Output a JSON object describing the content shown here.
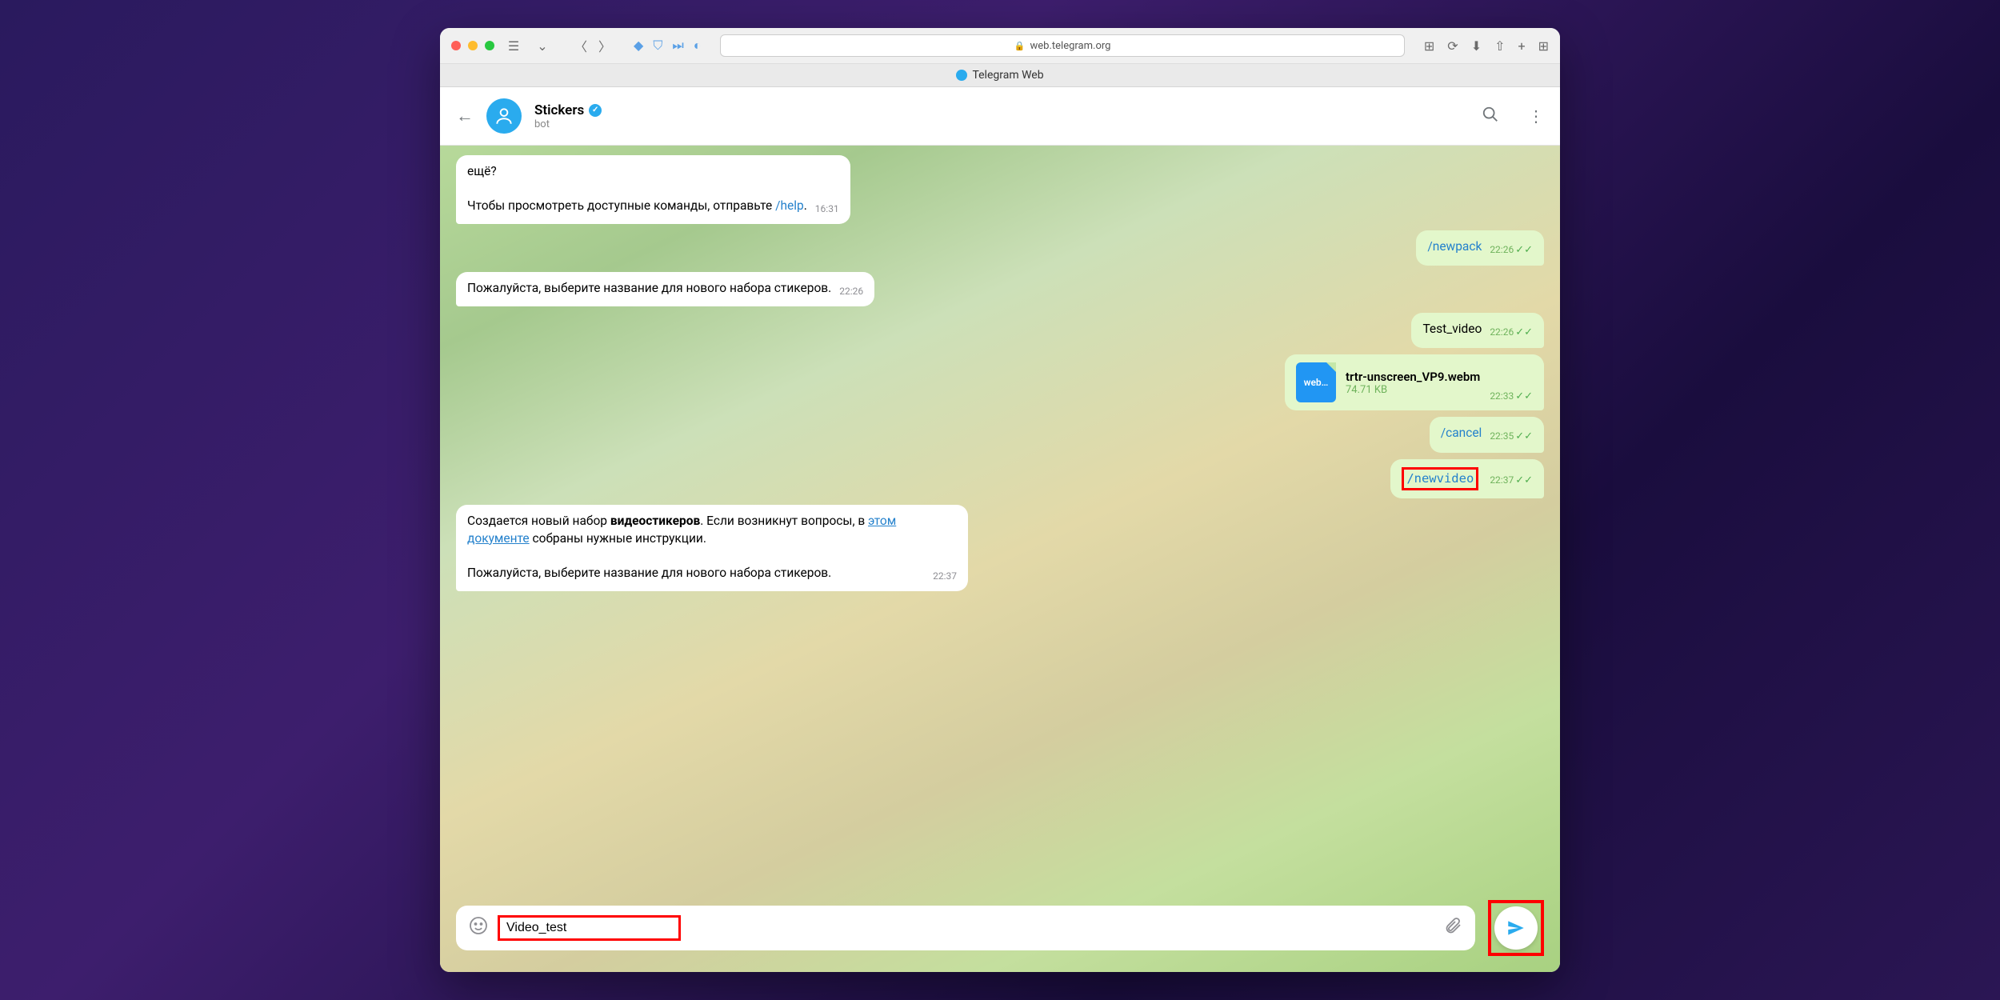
{
  "browser": {
    "url": "web.telegram.org",
    "tab_title": "Telegram Web"
  },
  "chat": {
    "name": "Stickers",
    "subtitle": "bot"
  },
  "messages": {
    "m1_line1": "ещё?",
    "m1_line2_pre": "Чтобы просмотреть доступные команды, отправьте ",
    "m1_cmd": "/help",
    "m1_post": ".",
    "m1_time": "16:31",
    "m2_cmd": "/newpack",
    "m2_time": "22:26",
    "m3_text": "Пожалуйста, выберите название для нового набора стикеров.",
    "m3_time": "22:26",
    "m4_text": "Test_video",
    "m4_time": "22:26",
    "file_name": "trtr-unscreen_VP9.webm",
    "file_size": "74.71 KB",
    "file_ext": "web…",
    "file_time": "22:33",
    "m6_cmd": "/cancel",
    "m6_time": "22:35",
    "m7_cmd": "/newvideo",
    "m7_time": "22:37",
    "m8_pre": "Создается новый набор ",
    "m8_bold": "видеостикеров",
    "m8_mid": ". Если возникнут вопросы, в ",
    "m8_link": "этом документе",
    "m8_post": " собраны нужные инструкции.",
    "m8_line2": "Пожалуйста, выберите название для нового набора стикеров.",
    "m8_time": "22:37"
  },
  "compose": {
    "value": "Video_test"
  }
}
